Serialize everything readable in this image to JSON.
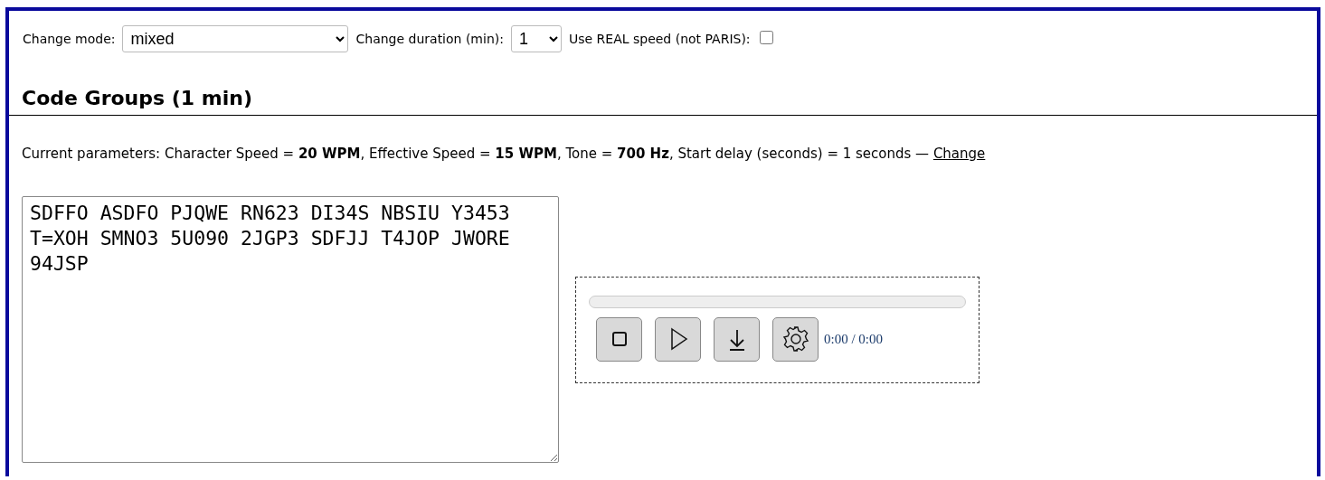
{
  "controls": [
    {
      "kind": "select",
      "label": "Change mode:",
      "value": "mixed"
    },
    {
      "kind": "select",
      "label": "Change duration (min):",
      "value": "1"
    },
    {
      "kind": "checkbox",
      "label": "Use REAL speed (not PARIS):",
      "checked": false
    }
  ],
  "heading": "Code Groups (1 min)",
  "parameters": {
    "text": "Current parameters: Character Speed = **20 WPM**, Effective Speed = **15 WPM**, Tone = **700 Hz**, Start delay (seconds) = 1 seconds —",
    "link": "Change"
  },
  "code_text": "SDFFO ASDFO PJQWE RN623 DI34S NBSIU Y3453 T=XOH SMNO3 5U090 2JGP3 SDFJJ T4JOP JWORE 94JSP",
  "player": {
    "progress": {
      "level": 0
    },
    "buttons": [
      {
        "kind": "stop"
      },
      {
        "kind": "play"
      },
      {
        "kind": "download"
      },
      {
        "kind": "settings"
      }
    ],
    "time": "0:00 / 0:00"
  }
}
